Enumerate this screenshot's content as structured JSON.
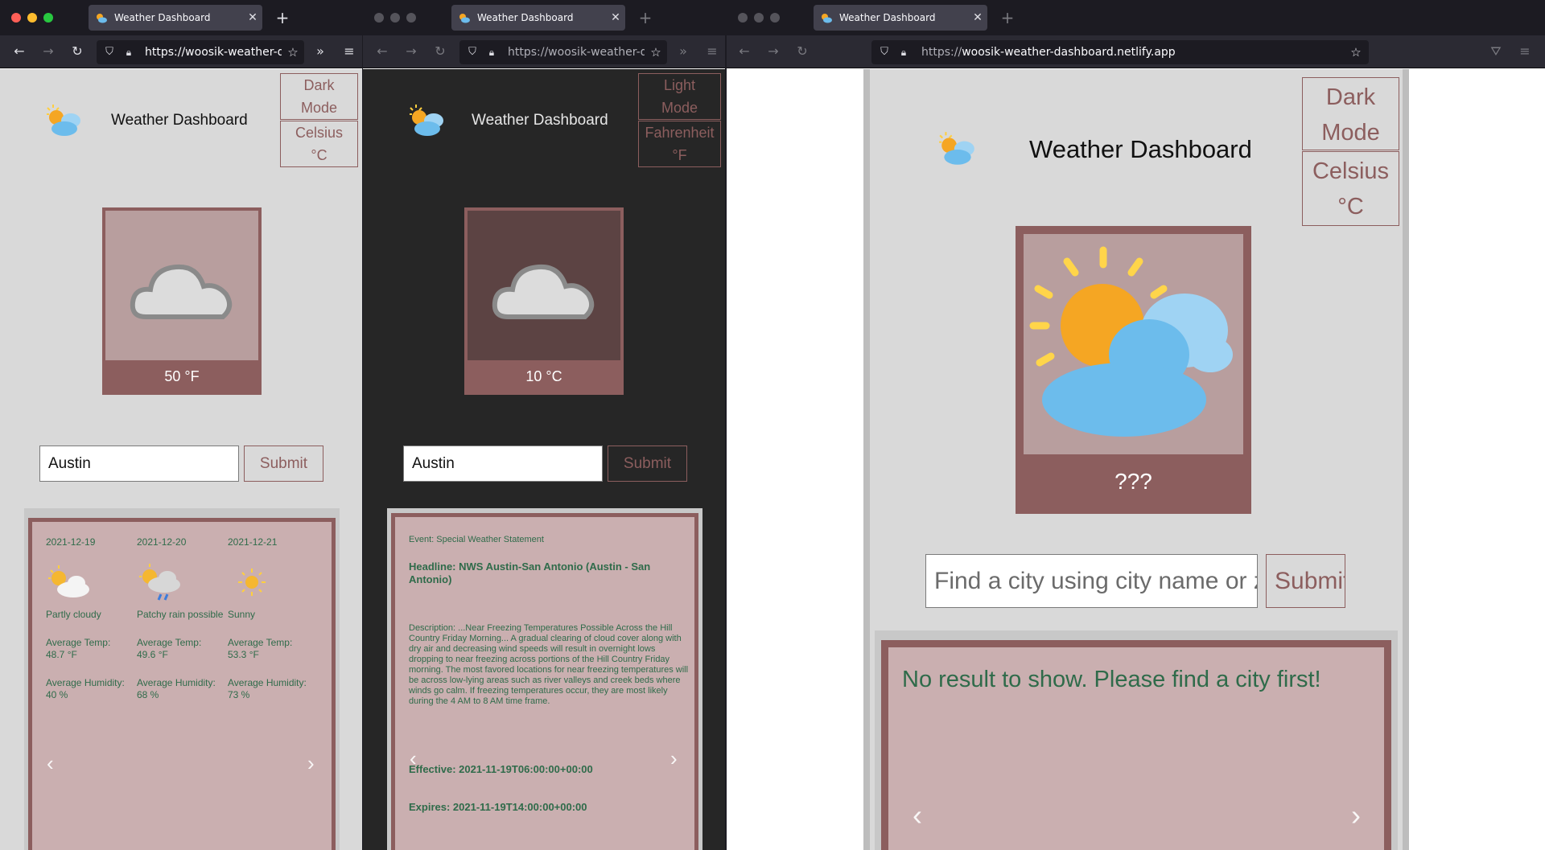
{
  "browser": {
    "tab_title": "Weather Dashboard",
    "url_short": "https://woosik-weather-d",
    "url_domain": "woosik-weather-dashboard.netlify.app",
    "url_protocol": "https://"
  },
  "app": {
    "title": "Weather Dashboard"
  },
  "windows": [
    {
      "theme_toggle": [
        "Dark",
        "Mode"
      ],
      "unit_toggle": [
        "Celsius",
        "°C"
      ],
      "current_temp": "50 °F",
      "search_value": "Austin",
      "submit_label": "Submit",
      "forecast": [
        {
          "date": "2021-12-19",
          "condition": "Partly cloudy",
          "icon": "partly-cloudy-icon",
          "avg_temp_label": "Average Temp:",
          "avg_temp": "48.7 °F",
          "avg_hum_label": "Average Humidity:",
          "avg_hum": "40 %"
        },
        {
          "date": "2021-12-20",
          "condition": "Patchy rain possible",
          "icon": "patchy-rain-icon",
          "avg_temp_label": "Average Temp:",
          "avg_temp": "49.6 °F",
          "avg_hum_label": "Average Humidity:",
          "avg_hum": "68 %"
        },
        {
          "date": "2021-12-21",
          "condition": "Sunny",
          "icon": "sun-icon",
          "avg_temp_label": "Average Temp:",
          "avg_temp": "53.3 °F",
          "avg_hum_label": "Average Humidity:",
          "avg_hum": "73 %"
        }
      ]
    },
    {
      "theme_toggle": [
        "Light",
        "Mode"
      ],
      "unit_toggle": [
        "Fahrenheit",
        "°F"
      ],
      "current_temp": "10 °C",
      "search_value": "Austin",
      "submit_label": "Submit",
      "alert": {
        "event": "Event: Special Weather Statement",
        "headline": "Headline: NWS Austin-San Antonio (Austin - San Antonio)",
        "description": "Description: ...Near Freezing Temperatures Possible Across the Hill Country Friday Morning... A gradual clearing of cloud cover along with dry air and decreasing wind speeds will result in overnight lows dropping to near freezing across portions of the Hill Country Friday morning. The most favored locations for near freezing temperatures will be across low-lying areas such as river valleys and creek beds where winds go calm. If freezing temperatures occur, they are most likely during the 4 AM to 8 AM time frame.",
        "effective": "Effective: 2021-11-19T06:00:00+00:00",
        "expires": "Expires: 2021-11-19T14:00:00+00:00"
      }
    },
    {
      "theme_toggle": [
        "Dark",
        "Mode"
      ],
      "unit_toggle": [
        "Celsius",
        "°C"
      ],
      "current_temp": "???",
      "search_placeholder": "Find a city using city name or zip code",
      "submit_label": "Submit",
      "empty_message": "No result to show. Please find a city first!"
    }
  ],
  "colors": {
    "accent": "#8c5e5e",
    "card_image_bg": "#b89e9e",
    "carousel_bg": "#caafb0",
    "forecast_text": "#2f6b4a",
    "light_bg": "#d9d9d9",
    "dark_bg": "#262626"
  }
}
